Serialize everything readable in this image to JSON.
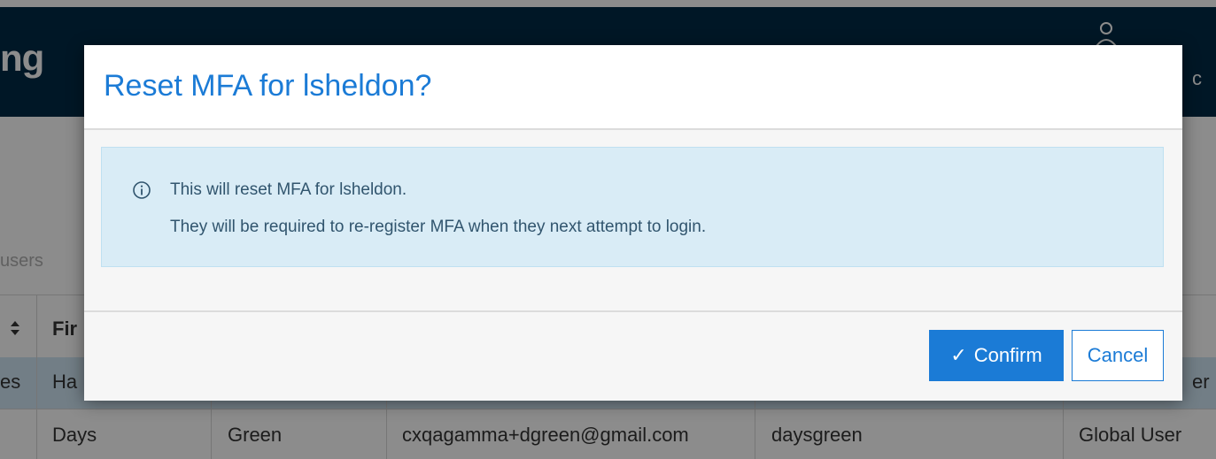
{
  "background": {
    "app_title_fragment": "ng",
    "user_name_fragment": "c",
    "search_placeholder_fragment": "users",
    "table": {
      "header_fragments": [
        "",
        "Fir"
      ],
      "rows": [
        [
          "es",
          "Ha",
          "",
          "",
          "",
          "er"
        ],
        [
          "",
          "Days",
          "Green",
          "cxqagamma+dgreen@gmail.com",
          "daysgreen",
          "Global User"
        ]
      ]
    }
  },
  "modal": {
    "title": "Reset MFA for lsheldon?",
    "alert": {
      "icon": "info-icon",
      "line1": "This will reset MFA for lsheldon.",
      "line2": "They will be required to re-register MFA when they next attempt to login."
    },
    "buttons": {
      "confirm_icon": "✓",
      "confirm_label": "Confirm",
      "cancel_label": "Cancel"
    }
  },
  "colors": {
    "accent": "#1b7bd6",
    "header_bg": "#002b45",
    "alert_bg": "#d9ecf6",
    "alert_text": "#31556e"
  }
}
